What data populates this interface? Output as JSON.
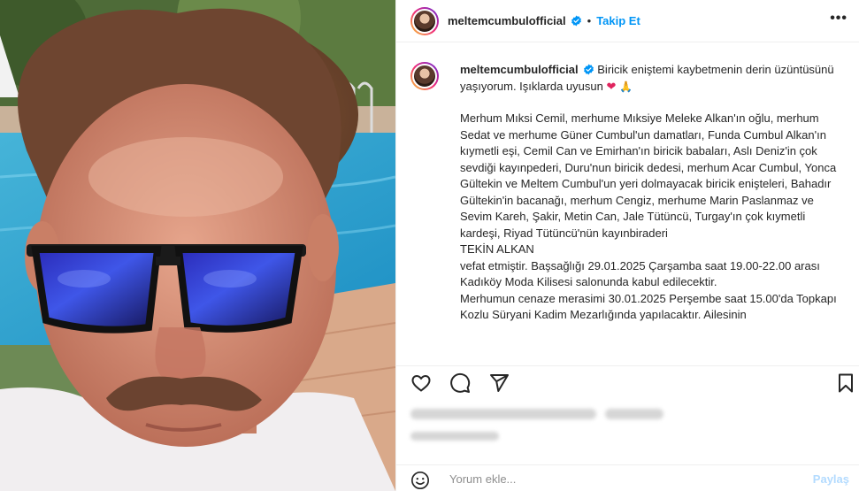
{
  "post": {
    "username": "meltemcumbulofficial",
    "follow_label": "Takip Et",
    "separator": "•",
    "caption_lead": "Biricik eniştemi kaybetmenin derin üzüntüsünü yaşıyorum. Işıklarda uyusun",
    "caption_body": "Merhum Mıksi Cemil, merhume Mıksiye Meleke Alkan'ın oğlu, merhum Sedat ve merhume Güner Cumbul'un damatları, Funda Cumbul Alkan'ın kıymetli eşi, Cemil Can ve Emirhan'ın biricik babaları, Aslı Deniz'in çok sevdiği kayınpederi, Duru'nun biricik dedesi, merhum Acar Cumbul, Yonca Gültekin ve Meltem Cumbul'un yeri dolmayacak biricik enişteleri, Bahadır Gültekin'in bacanağı, merhum Cengiz, merhume Marin Paslanmaz ve Sevim Kareh, Şakir, Metin Can, Jale Tütüncü, Turgay'ın çok kıymetli kardeşi, Riyad Tütüncü'nün kayınbiraderi",
    "deceased_name": "TEKİN ALKAN",
    "funeral_line1": "vefat etmiştir. Başsağlığı 29.01.2025 Çarşamba saat 19.00-22.00 arası Kadıköy Moda Kilisesi salonunda kabul edilecektir.",
    "funeral_line2": "Merhumun cenaze merasimi 30.01.2025 Perşembe saat 15.00'da Topkapı Kozlu Süryani Kadim Mezarlığında yapılacaktır. Ailesinin"
  },
  "comment": {
    "placeholder": "Yorum ekle...",
    "post_label": "Paylaş"
  },
  "icons": {
    "verified": "verified-badge-icon",
    "heart": "heart-icon",
    "comment": "comment-icon",
    "share": "share-icon",
    "save": "bookmark-icon",
    "emoji": "emoji-icon",
    "more": "more-options-icon"
  },
  "colors": {
    "accent": "#0095f6",
    "verified": "#0095f6",
    "text": "#262626",
    "muted": "#8e8e8e",
    "post_disabled": "#b3dbff"
  }
}
